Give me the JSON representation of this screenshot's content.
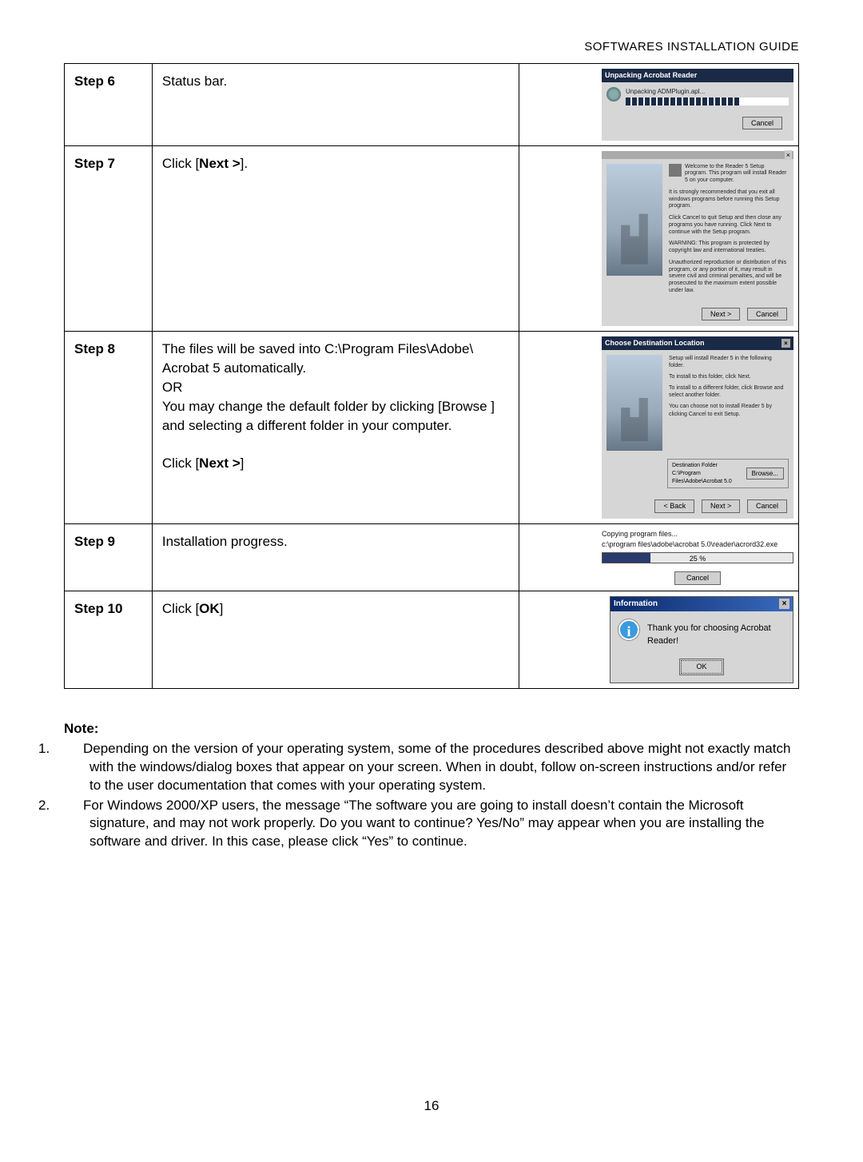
{
  "header": "SOFTWARES INSTALLATION GUIDE",
  "page_number": "16",
  "steps": {
    "s6": {
      "label": "Step 6",
      "desc": "Status bar.",
      "mock": {
        "title": "Unpacking Acrobat Reader",
        "line": "Unpacking ADMPlugin.apl...",
        "cancel": "Cancel"
      }
    },
    "s7": {
      "label": "Step 7",
      "desc_prefix": "Click [",
      "desc_bold": "Next >",
      "desc_suffix": "].",
      "mock": {
        "p1": "Welcome to the Reader 5 Setup program. This program will install Reader 5 on your computer.",
        "p2": "It is strongly recommended that you exit all windows programs before running this Setup program.",
        "p3": "Click Cancel to quit Setup and then close any programs you have running. Click Next to continue with the Setup program.",
        "p4": "WARNING: This program is protected by copyright law and international treaties.",
        "p5": "Unauthorized reproduction or distribution of this program, or any portion of it, may result in severe civil and criminal penalties, and will be prosecuted to the maximum extent possible under law.",
        "next": "Next >",
        "cancel": "Cancel"
      }
    },
    "s8": {
      "label": "Step 8",
      "desc_l1": "The files will be saved into C:\\Program Files\\Adobe\\",
      "desc_l2": "Acrobat 5 automatically.",
      "desc_l3": "OR",
      "desc_l4": "You may change the default folder by clicking [Browse ] and selecting a different folder in your computer.",
      "desc_l5a": "Click [",
      "desc_l5b": "Next >",
      "desc_l5c": "]",
      "mock": {
        "title": "Choose Destination Location",
        "p1": "Setup will install Reader 5 in the following folder.",
        "p2": "To install to this folder, click Next.",
        "p3": "To install to a different folder, click Browse and select another folder.",
        "p4": "You can choose not to install Reader 5 by clicking Cancel to exit Setup.",
        "dest_label": "Destination Folder",
        "dest_path": "C:\\Program Files\\Adobe\\Acrobat 5.0",
        "browse": "Browse...",
        "back": "< Back",
        "next": "Next >",
        "cancel": "Cancel"
      }
    },
    "s9": {
      "label": "Step 9",
      "desc": "Installation progress.",
      "mock": {
        "l1": "Copying program files...",
        "l2": "c:\\program files\\adobe\\acrobat 5.0\\reader\\acrord32.exe",
        "pct": "25 %",
        "cancel": "Cancel"
      }
    },
    "s10": {
      "label": "Step 10",
      "desc_prefix": "Click [",
      "desc_bold": "OK",
      "desc_suffix": "]",
      "mock": {
        "title": "Information",
        "msg": "Thank you for choosing Acrobat Reader!",
        "ok": "OK"
      }
    }
  },
  "note": {
    "heading": "Note:",
    "n1": "Depending on the version of your operating system, some of the procedures described above might not exactly match with the windows/dialog boxes that appear on your screen. When in doubt, follow on-screen instructions and/or refer to the user documentation that comes with your operating system.",
    "n2": "For Windows 2000/XP users, the message “The software you are going to install doesn’t contain the Microsoft signature, and may not work properly. Do you want to continue? Yes/No” may appear when you are installing the software and driver. In this case, please click “Yes” to continue."
  }
}
